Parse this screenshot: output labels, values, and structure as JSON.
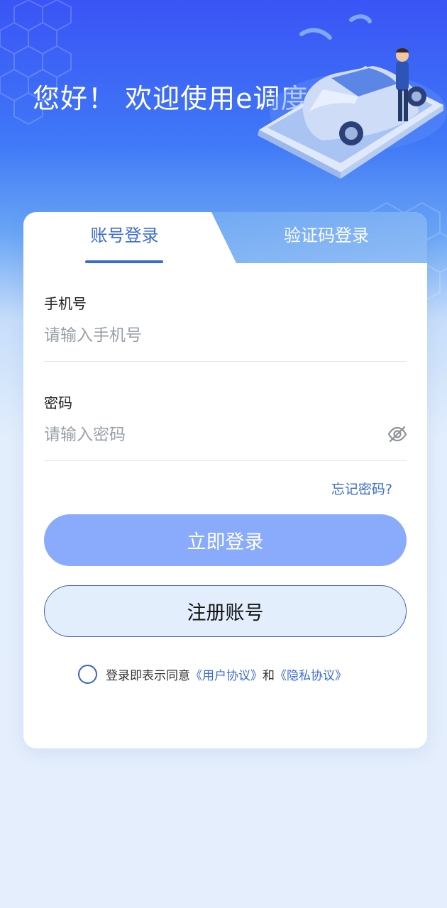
{
  "header": {
    "greeting": "您好！ 欢迎使用e调度"
  },
  "tabs": [
    {
      "label": "账号登录",
      "active": true
    },
    {
      "label": "验证码登录",
      "active": false
    }
  ],
  "form": {
    "phone": {
      "label": "手机号",
      "placeholder": "请输入手机号",
      "value": ""
    },
    "password": {
      "label": "密码",
      "placeholder": "请输入密码",
      "value": "",
      "toggle_icon": "eye-off-icon"
    },
    "forgot_label": "忘记密码?",
    "login_label": "立即登录",
    "register_label": "注册账号"
  },
  "agreement": {
    "prefix": "登录即表示同意",
    "user_agreement": "《用户协议》",
    "conjunction": "和",
    "privacy_policy": "《隐私协议》",
    "checked": false
  },
  "colors": {
    "primary": "#3a6bd1",
    "login_button": "#8aaafc",
    "header_top": "#3a54f5",
    "page_bg": "#e4eefc"
  }
}
